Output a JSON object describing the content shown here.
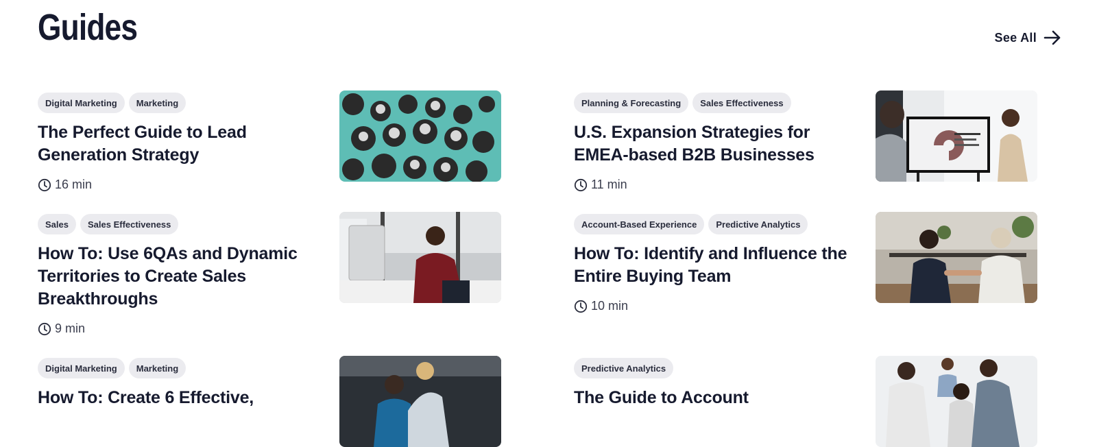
{
  "header": {
    "title": "Guides",
    "see_all_label": "See All"
  },
  "guides": [
    {
      "tags": [
        "Digital Marketing",
        "Marketing"
      ],
      "title": "The Perfect Guide to Lead Generation Strategy",
      "duration": "16 min",
      "image": "crowd-of-people-cheering"
    },
    {
      "tags": [
        "Planning & Forecasting",
        "Sales Effectiveness"
      ],
      "title": "U.S. Expansion Strategies for EMEA-based B2B Businesses",
      "duration": "11 min",
      "image": "presentation-with-chart-screen"
    },
    {
      "tags": [
        "Sales",
        "Sales Effectiveness"
      ],
      "title": "How To: Use 6QAs and Dynamic Territories to Create Sales Breakthroughs",
      "duration": "9 min",
      "image": "man-on-phone-at-desk"
    },
    {
      "tags": [
        "Account-Based Experience",
        "Predictive Analytics"
      ],
      "title": "How To: Identify and Influence the Entire Buying Team",
      "duration": "10 min",
      "image": "handshake-in-office"
    },
    {
      "tags": [
        "Digital Marketing",
        "Marketing"
      ],
      "title": "How To: Create 6 Effective,",
      "duration": "",
      "image": "coworkers-at-laptop"
    },
    {
      "tags": [
        "Predictive Analytics"
      ],
      "title": "The Guide to Account",
      "duration": "",
      "image": "team-celebrating"
    }
  ],
  "colors": {
    "text": "#161a2e",
    "tag_bg": "#ebebef",
    "crowd_bg": "#5ebdb5"
  }
}
